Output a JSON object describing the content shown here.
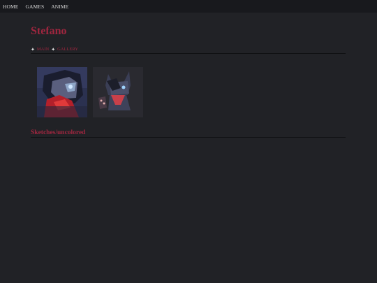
{
  "nav": {
    "items": [
      {
        "label": "HOME"
      },
      {
        "label": "GAMES"
      },
      {
        "label": "ANIME"
      }
    ]
  },
  "page": {
    "title": "Stefano"
  },
  "breadcrumb": {
    "items": [
      {
        "label": "MAIN"
      },
      {
        "label": "GALLERY"
      }
    ]
  },
  "gallery": {
    "thumbnails": [
      {
        "name": "thumbnail-colored-portrait"
      },
      {
        "name": "thumbnail-chibi-wolf"
      }
    ]
  },
  "sections": {
    "sketches_title": "Sketches/uncolored"
  },
  "colors": {
    "background": "#212226",
    "nav_background": "#18191d",
    "accent": "#a0263f"
  }
}
